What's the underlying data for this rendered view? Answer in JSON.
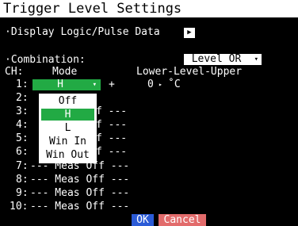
{
  "title": "Trigger Level Settings",
  "display_logic_pulse": {
    "label": "·Display Logic/Pulse Data",
    "button_glyph": "▶"
  },
  "combination": {
    "label": "·Combination:",
    "value": "Level OR",
    "arrow": "▾"
  },
  "headers": {
    "ch": "CH:",
    "mode": "Mode",
    "level": "Lower-Level-Upper"
  },
  "channel_1": {
    "label": "1:",
    "mode": "H",
    "mode_arrow": "▾",
    "sign": "+",
    "level_value": "0",
    "level_arrow": "▸",
    "unit": "˚C"
  },
  "channel_rows": [
    {
      "label": "2:",
      "rest": ""
    },
    {
      "label": "3:",
      "rest": "f ---"
    },
    {
      "label": "4:",
      "rest": "f ---"
    },
    {
      "label": "5:",
      "rest": "f ---"
    },
    {
      "label": "6:",
      "rest": "f ---"
    },
    {
      "label": "7:",
      "rest": "--- Meas Off ---"
    },
    {
      "label": "8:",
      "rest": "--- Meas Off ---"
    },
    {
      "label": "9:",
      "rest": "--- Meas Off ---"
    },
    {
      "label": "10:",
      "rest": "--- Meas Off ---"
    }
  ],
  "mode_dropdown": {
    "options": [
      "Off",
      "H",
      "L",
      "Win In",
      "Win Out"
    ],
    "selected_index": 1
  },
  "buttons": {
    "ok": "OK",
    "cancel": "Cancel"
  },
  "colors": {
    "background": "#000000",
    "title_bar": "#ffffff",
    "selected_green": "#22aa44",
    "ok_blue": "#2b5bd6",
    "cancel_red": "#e26b6b"
  }
}
